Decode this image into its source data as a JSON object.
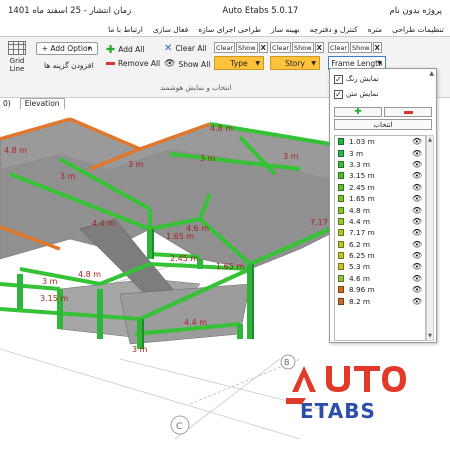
{
  "title": {
    "project": "پروژه بدون نام",
    "app": "Auto Etabs 5.0.17",
    "time_label": "زمان انتشار - 25 اسفند ماه 1401"
  },
  "menu": [
    "تنظیمات طراحی",
    "متره",
    "کنترل و دفترچه",
    "بهینه ساز",
    "طراحی اجرای سازه",
    "فعال سازی",
    "ارتباط با ما"
  ],
  "ribbon": {
    "grid_line": "Grid Line",
    "add_option": "+ Add Option",
    "add_option_hint": "افزودن گزینه ها",
    "add_all": "Add All",
    "remove_all": "Remove All",
    "clear_all": "Clear All",
    "show_all": "Show All",
    "filters": [
      {
        "name": "Type",
        "clear": "Clear",
        "show": "Show",
        "x": "X"
      },
      {
        "name": "Story",
        "clear": "Clear",
        "show": "Show",
        "x": "X"
      },
      {
        "name": "Frame Length",
        "clear": "Clear",
        "show": "Show",
        "x": "X"
      }
    ],
    "caption": "انتخاب و نمایش هوشمند"
  },
  "tabs": {
    "number": "0)",
    "elevation": "Elevation"
  },
  "panel": {
    "show_color": "نمایش رنگ",
    "show_text": "نمایش متن",
    "select": "انتخاب",
    "items": [
      {
        "label": "1.03 m",
        "color": "#21b34a"
      },
      {
        "label": "3 m",
        "color": "#2cb84a"
      },
      {
        "label": "3.3 m",
        "color": "#3fba3c"
      },
      {
        "label": "3.15 m",
        "color": "#4fbd30"
      },
      {
        "label": "2.45 m",
        "color": "#5fc02b"
      },
      {
        "label": "1.65 m",
        "color": "#72c42a"
      },
      {
        "label": "4.8 m",
        "color": "#83c72a"
      },
      {
        "label": "4.4 m",
        "color": "#93ca2a"
      },
      {
        "label": "7.17 m",
        "color": "#a3cb29"
      },
      {
        "label": "6.2 m",
        "color": "#b2c826"
      },
      {
        "label": "6.25 m",
        "color": "#c2c524"
      },
      {
        "label": "5.3 m",
        "color": "#cfbe24"
      },
      {
        "label": "4.6 m",
        "color": "#8ec63f"
      },
      {
        "label": "8.96 m",
        "color": "#d56a1e"
      },
      {
        "label": "8.2 m",
        "color": "#c96a20"
      }
    ]
  },
  "model_labels": [
    "4.8 m",
    "4.8 m",
    "3 m",
    "3 m",
    "3 m",
    "3 m",
    "4.4 m",
    "1.65 m",
    "4.6 m",
    "2.45 m",
    "1.65 m",
    "7.17 m",
    "4.8 m",
    "3.15 m",
    "3 m",
    "4.4 m",
    "3 m"
  ],
  "grid_bubbles": [
    "B",
    "C"
  ],
  "logo": {
    "top": "AUTO",
    "bottom": "ETABS"
  },
  "colors": {
    "beam_green": "#35c236",
    "column_green": "#2fb53a",
    "slab_gray": "#8f8f8f",
    "orange": "#e0772a",
    "accent_red": "#e23a2a",
    "accent_blue": "#2d4ea8"
  }
}
